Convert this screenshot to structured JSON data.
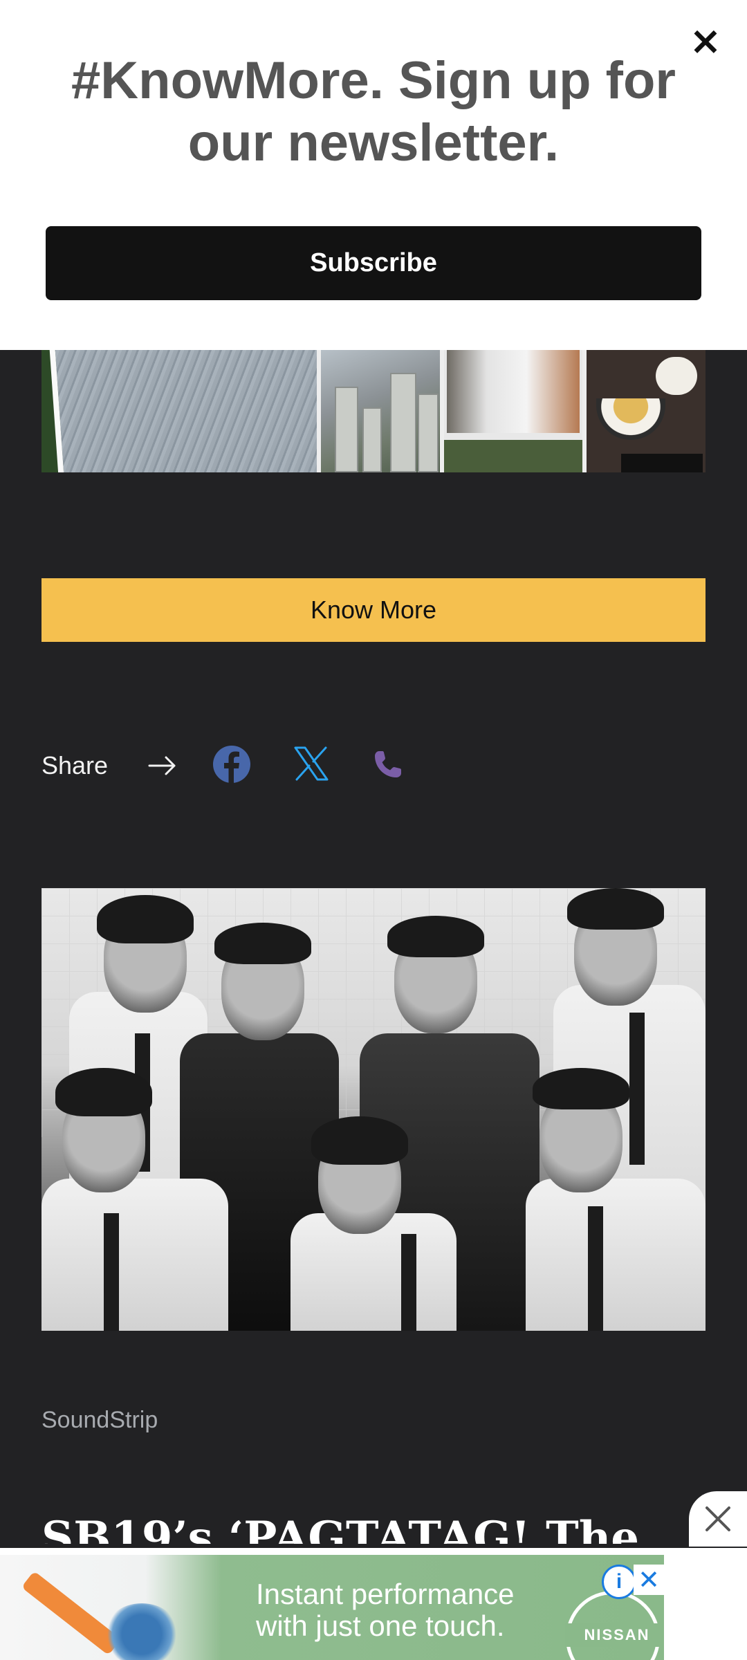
{
  "newsletter": {
    "close_label": "×",
    "title": "#KnowMore. Sign up for our newsletter.",
    "subscribe_label": "Subscribe"
  },
  "know_more": {
    "label": "Know More"
  },
  "share": {
    "label": "Share",
    "icons": [
      "arrow-right-icon",
      "facebook-icon",
      "x-twitter-icon",
      "phone-icon"
    ],
    "colors": {
      "facebook": "#4867aa",
      "x": "#2aa3ef",
      "phone": "#7b5ea7"
    }
  },
  "article": {
    "category": "SoundStrip",
    "headline": "SB19’s ‘PAGTATAG! The"
  },
  "ad": {
    "text_line1": "Instant performance",
    "text_line2": "with just one touch.",
    "brand": "NISSAN",
    "info_label": "i",
    "close_label": "✕"
  },
  "colors": {
    "page_bg": "#222224",
    "accent_button": "#f5c04f",
    "subscribe_bg": "#121212",
    "title_text": "#555555"
  }
}
